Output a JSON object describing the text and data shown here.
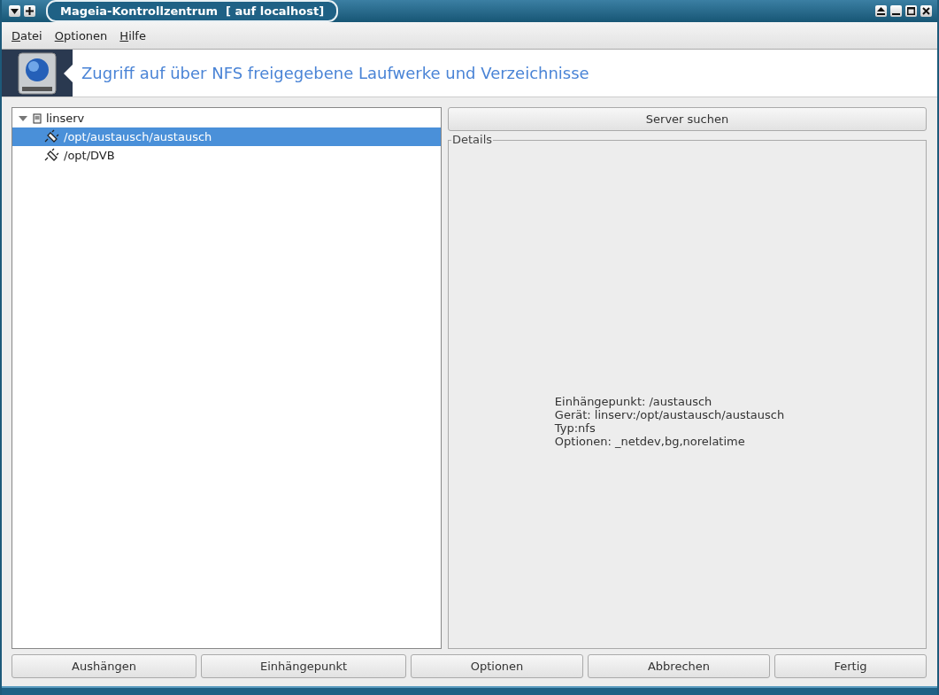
{
  "window": {
    "title": "Mageia-Kontrollzentrum  [ auf localhost]"
  },
  "menu": [
    "Datei",
    "Optionen",
    "Hilfe"
  ],
  "header": {
    "title": "Zugriff auf über NFS freigegebene Laufwerke und Verzeichnisse"
  },
  "tree": [
    {
      "label": "linserv",
      "expanded": true,
      "selected": false,
      "children": [
        {
          "label": "/opt/austausch/austausch",
          "selected": true
        },
        {
          "label": "/opt/DVB",
          "selected": false
        }
      ]
    }
  ],
  "search_button": "Server suchen",
  "details": {
    "title": "Details",
    "lines": [
      "Einhängepunkt: /austausch",
      "Gerät: linserv:/opt/austausch/austausch",
      "Typ:nfs",
      "Optionen: _netdev,bg,norelatime"
    ]
  },
  "buttons": [
    "Aushängen",
    "Einhängepunkt",
    "Optionen",
    "Abbrechen",
    "Fertig"
  ]
}
